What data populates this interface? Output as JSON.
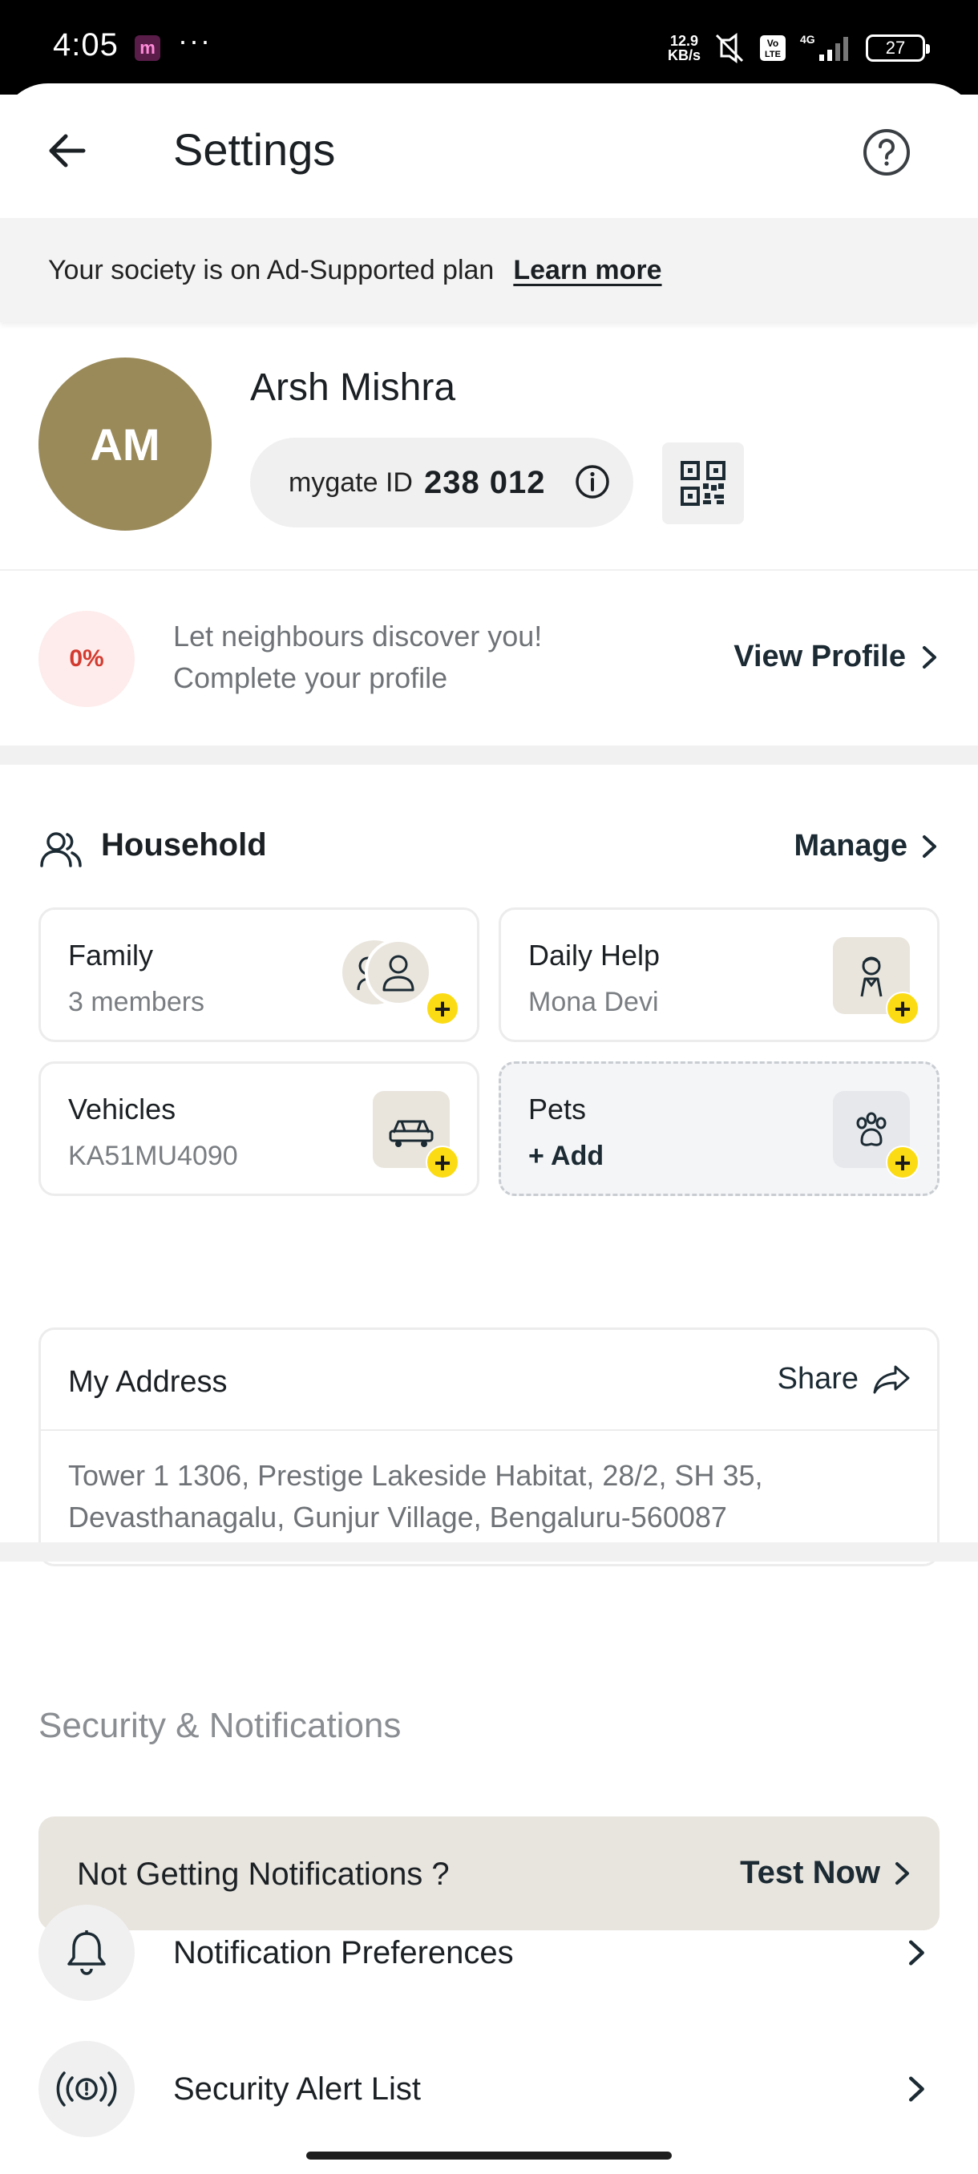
{
  "status_bar": {
    "time": "4:05",
    "app_badge": "m",
    "more": "···",
    "net_speed_value": "12.9",
    "net_speed_unit": "KB/s",
    "volte": "Vo LTE",
    "network": "4G",
    "battery": "27"
  },
  "header": {
    "title": "Settings",
    "back_icon": "arrow-left-icon",
    "help_icon": "question-circle-icon"
  },
  "plan_banner": {
    "text": "Your society is on Ad-Supported plan",
    "link": "Learn more"
  },
  "profile": {
    "initials": "AM",
    "avatar_color": "#9a8a5a",
    "name": "Arsh Mishra",
    "id_label": "mygate ID",
    "id_value": "238 012",
    "completion": "0%",
    "discover_line1": "Let neighbours discover you!",
    "discover_line2": "Complete your profile",
    "view_profile": "View Profile"
  },
  "household": {
    "title": "Household",
    "manage": "Manage",
    "cards": [
      {
        "title": "Family",
        "sub": "3 members",
        "icon": "people-icon"
      },
      {
        "title": "Daily Help",
        "sub": "Mona Devi",
        "icon": "helper-icon"
      },
      {
        "title": "Vehicles",
        "sub": "KA51MU4090",
        "icon": "car-icon"
      },
      {
        "title": "Pets",
        "sub": "+ Add",
        "icon": "paw-icon"
      }
    ]
  },
  "address": {
    "title": "My Address",
    "share": "Share",
    "text": "Tower 1 1306, Prestige Lakeside Habitat, 28/2, SH 35, Devasthanagalu, Gunjur Village, Bengaluru-560087"
  },
  "security": {
    "heading": "Security & Notifications",
    "banner_text": "Not Getting Notifications ?",
    "banner_action": "Test Now",
    "items": [
      {
        "label": "Notification Preferences",
        "icon": "bell-icon"
      },
      {
        "label": "Security Alert List",
        "icon": "alarm-icon"
      }
    ]
  },
  "colors": {
    "accent_yellow": "#fbdc14",
    "text_dark": "#1b2a33",
    "badge_red": "#d33a2f"
  }
}
